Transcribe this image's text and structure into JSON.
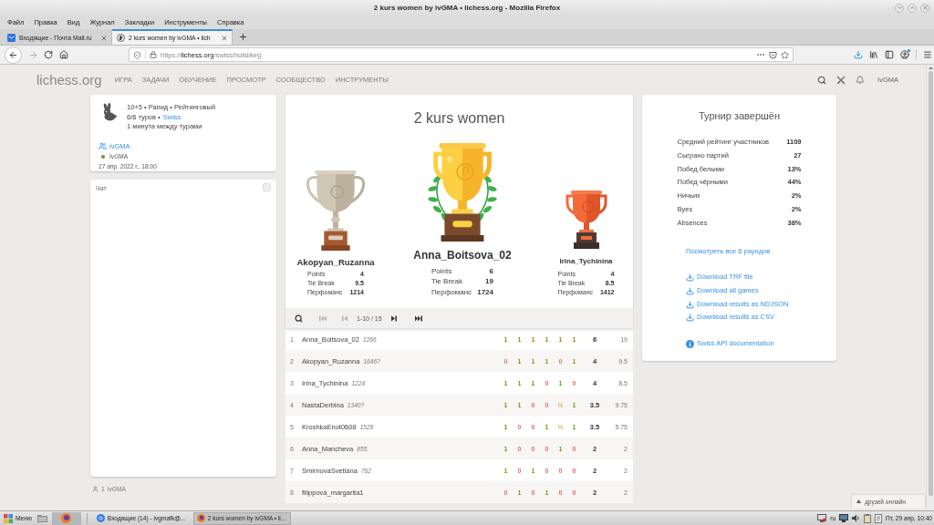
{
  "window": {
    "title": "2 kurs women by ivGMA • lichess.org - Mozilla Firefox"
  },
  "menu_bar": [
    "Файл",
    "Правка",
    "Вид",
    "Журнал",
    "Закладки",
    "Инструменты",
    "Справка"
  ],
  "browser_tabs": [
    {
      "title": "Входящие - Почта Mail.ru",
      "kind": "mail",
      "selected": false
    },
    {
      "title": "2 kurs women by ivGMA • lich",
      "kind": "chess",
      "selected": true
    }
  ],
  "navigation": {
    "forward_disabled": true,
    "url": "https://lichess.org/swiss/holldAeg"
  },
  "site_header": {
    "logo": "lichess.org",
    "nav": [
      "ИГРА",
      "ЗАДАЧИ",
      "ОБУЧЕНИЕ",
      "ПРОСМОТР",
      "СООБЩЕСТВО",
      "ИНСТРУМЕНТЫ"
    ],
    "user": "IvGMA"
  },
  "tournament_info": {
    "setup": "10+5 • Рапид • Рейтинговый",
    "rounds": "6/6 туров •",
    "system": "Swiss",
    "interval": "1 минута между турами",
    "team": "ivGMA",
    "leader": {
      "name": "IvGMA",
      "online": true
    },
    "date": "27 апр. 2022 г., 18:00"
  },
  "chat": {
    "title": "Чат",
    "enabled": false
  },
  "spectators": {
    "count": "1",
    "names": "IvGMA"
  },
  "podium": {
    "title": "2 kurs women",
    "places": [
      {
        "kind": "silver",
        "name": "Akopyan_Ruzanna",
        "stats": [
          {
            "label": "Points",
            "value": "4"
          },
          {
            "label": "Tie Break",
            "value": "9.5"
          },
          {
            "label": "Перфоманс",
            "value": "1214"
          }
        ]
      },
      {
        "kind": "gold",
        "name": "Anna_Boitsova_02",
        "stats": [
          {
            "label": "Points",
            "value": "6"
          },
          {
            "label": "Tie Break",
            "value": "19"
          },
          {
            "label": "Перфоманс",
            "value": "1724"
          }
        ]
      },
      {
        "kind": "bronze",
        "name": "Irina_Tychinina",
        "stats": [
          {
            "label": "Points",
            "value": "4"
          },
          {
            "label": "Tie Break",
            "value": "8.5"
          },
          {
            "label": "Перфоманс",
            "value": "1412"
          }
        ]
      }
    ]
  },
  "pager": {
    "first_disabled": true,
    "prev_disabled": true,
    "range": "1-10 / 15",
    "next_disabled": false,
    "last_disabled": false
  },
  "standings": [
    {
      "rank": "1",
      "name": "Anna_Boitsova_02",
      "rating": "1266",
      "results": [
        {
          "text": "1",
          "kind": "win"
        },
        {
          "text": "1",
          "kind": "win"
        },
        {
          "text": "1",
          "kind": "win"
        },
        {
          "text": "1",
          "kind": "win"
        },
        {
          "text": "1",
          "kind": "win"
        },
        {
          "text": "1",
          "kind": "win"
        }
      ],
      "points": "6",
      "tie_break": "19"
    },
    {
      "rank": "2",
      "name": "Akopyan_Ruzanna",
      "rating": "1646?",
      "results": [
        {
          "text": "0",
          "kind": "loss"
        },
        {
          "text": "1",
          "kind": "win"
        },
        {
          "text": "1",
          "kind": "win"
        },
        {
          "text": "1",
          "kind": "win"
        },
        {
          "text": "0",
          "kind": "loss"
        },
        {
          "text": "1",
          "kind": "win"
        }
      ],
      "points": "4",
      "tie_break": "9.5"
    },
    {
      "rank": "3",
      "name": "Irina_Tychinina",
      "rating": "1224",
      "results": [
        {
          "text": "1",
          "kind": "win"
        },
        {
          "text": "1",
          "kind": "win"
        },
        {
          "text": "1",
          "kind": "win"
        },
        {
          "text": "0",
          "kind": "loss"
        },
        {
          "text": "1",
          "kind": "win"
        },
        {
          "text": "0",
          "kind": "loss"
        }
      ],
      "points": "4",
      "tie_break": "8.5"
    },
    {
      "rank": "4",
      "name": "NastaDerbina",
      "rating": "1340?",
      "results": [
        {
          "text": "1",
          "kind": "win"
        },
        {
          "text": "1",
          "kind": "win"
        },
        {
          "text": "0",
          "kind": "loss"
        },
        {
          "text": "0",
          "kind": "loss"
        },
        {
          "text": "½",
          "kind": "draw"
        },
        {
          "text": "1",
          "kind": "win"
        }
      ],
      "points": "3.5",
      "tie_break": "9.75"
    },
    {
      "rank": "5",
      "name": "KroshkaEnot0608",
      "rating": "1528",
      "results": [
        {
          "text": "1",
          "kind": "win"
        },
        {
          "text": "0",
          "kind": "loss"
        },
        {
          "text": "0",
          "kind": "loss"
        },
        {
          "text": "1",
          "kind": "win"
        },
        {
          "text": "½",
          "kind": "draw"
        },
        {
          "text": "1",
          "kind": "win"
        }
      ],
      "points": "3.5",
      "tie_break": "5.75"
    },
    {
      "rank": "6",
      "name": "Anna_Mancheva",
      "rating": "855",
      "results": [
        {
          "text": "1",
          "kind": "win"
        },
        {
          "text": "0",
          "kind": "loss"
        },
        {
          "text": "0",
          "kind": "loss"
        },
        {
          "text": "0",
          "kind": "loss"
        },
        {
          "text": "1",
          "kind": "win"
        },
        {
          "text": "0",
          "kind": "loss"
        }
      ],
      "points": "2",
      "tie_break": "2"
    },
    {
      "rank": "7",
      "name": "SmirnovaSvetlana",
      "rating": "762",
      "results": [
        {
          "text": "1",
          "kind": "win"
        },
        {
          "text": "0",
          "kind": "loss"
        },
        {
          "text": "1",
          "kind": "win"
        },
        {
          "text": "0",
          "kind": "loss"
        },
        {
          "text": "0",
          "kind": "loss"
        },
        {
          "text": "0",
          "kind": "loss"
        }
      ],
      "points": "2",
      "tie_break": "2"
    },
    {
      "rank": "8",
      "name": "filippova_margarita1",
      "results": [
        {
          "text": "0",
          "kind": "loss"
        },
        {
          "text": "1",
          "kind": "win"
        },
        {
          "text": "0",
          "kind": "loss"
        },
        {
          "text": "1",
          "kind": "win"
        },
        {
          "text": "0",
          "kind": "loss"
        },
        {
          "text": "0",
          "kind": "loss"
        }
      ],
      "points": "2",
      "tie_break": "2"
    }
  ],
  "tournament_summary": {
    "title": "Турнир завершён",
    "stats": [
      {
        "label": "Средний рейтинг участников",
        "value": "1109"
      },
      {
        "label": "Сыграно партий",
        "value": "27"
      },
      {
        "label": "Побед белыми",
        "value": "13%"
      },
      {
        "label": "Побед чёрными",
        "value": "44%"
      },
      {
        "label": "Ничьих",
        "value": "2%"
      },
      {
        "label": "Byes",
        "value": "2%"
      },
      {
        "label": "Absences",
        "value": "38%"
      }
    ],
    "rounds_link": "Посмотреть все 6 раундов",
    "downloads": [
      "Download TRF file",
      "Download all games",
      "Download results as NDJSON",
      "Download results as CSV"
    ],
    "api_link": "Swiss API documentation"
  },
  "friends_button": "друзей онлайн",
  "taskbar": {
    "menu": "Меню",
    "tasks": [
      {
        "title": "Входящие (14) - ivgmafk@...",
        "selected": false
      },
      {
        "title": "2 kurs women by ivGMA • li...",
        "selected": true
      }
    ],
    "layout": "ru",
    "clock": "Пт, 29 апр, 10:40"
  }
}
